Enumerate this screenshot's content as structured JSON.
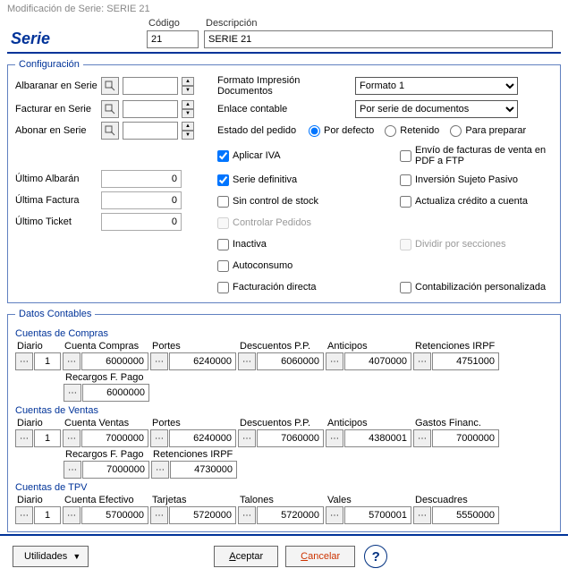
{
  "window_title": "Modificación de Serie: SERIE 21",
  "serie_label": "Serie",
  "header": {
    "codigo_label": "Código",
    "codigo_value": "21",
    "descripcion_label": "Descripción",
    "descripcion_value": "SERIE 21"
  },
  "config": {
    "legend": "Configuración",
    "albaranar_label": "Albaranar en Serie",
    "albaranar_value": "",
    "facturar_label": "Facturar en Serie",
    "facturar_value": "",
    "abonar_label": "Abonar en Serie",
    "abonar_value": "",
    "ultimo_albaran_label": "Último Albarán",
    "ultimo_albaran_value": "0",
    "ultima_factura_label": "Última Factura",
    "ultima_factura_value": "0",
    "ultimo_ticket_label": "Último Ticket",
    "ultimo_ticket_value": "0",
    "formato_label": "Formato Impresión Documentos",
    "formato_value": "Formato 1",
    "enlace_label": "Enlace contable",
    "enlace_value": "Por serie de documentos",
    "estado_label": "Estado del pedido",
    "estado_options": {
      "por_defecto": "Por defecto",
      "retenido": "Retenido",
      "para_preparar": "Para preparar"
    },
    "checks_left": {
      "aplicar_iva": "Aplicar IVA",
      "serie_definitiva": "Serie definitiva",
      "sin_control_stock": "Sin control de stock",
      "controlar_pedidos": "Controlar Pedidos",
      "inactiva": "Inactiva",
      "autoconsumo": "Autoconsumo",
      "facturacion_directa": "Facturación directa"
    },
    "checks_right": {
      "envio_pdf_ftp": "Envío de facturas de venta en PDF a FTP",
      "inversion_sujeto": "Inversión Sujeto Pasivo",
      "actualiza_credito": "Actualiza crédito a cuenta",
      "dividir_secciones": "Dividir por secciones",
      "contab_personalizada": "Contabilización personalizada"
    }
  },
  "datos": {
    "legend": "Datos Contables",
    "compras": {
      "title": "Cuentas de Compras",
      "headers": {
        "diario": "Diario",
        "cuenta": "Cuenta Compras",
        "portes": "Portes",
        "desc_pp": "Descuentos P.P.",
        "anticipos": "Anticipos",
        "ret_irpf": "Retenciones IRPF",
        "recargos": "Recargos F. Pago"
      },
      "values": {
        "diario": "1",
        "cuenta": "6000000",
        "portes": "6240000",
        "desc_pp": "6060000",
        "anticipos": "4070000",
        "ret_irpf": "4751000",
        "recargos": "6000000"
      }
    },
    "ventas": {
      "title": "Cuentas de Ventas",
      "headers": {
        "diario": "Diario",
        "cuenta": "Cuenta Ventas",
        "portes": "Portes",
        "desc_pp": "Descuentos P.P.",
        "anticipos": "Anticipos",
        "gastos": "Gastos Financ.",
        "recargos": "Recargos F. Pago",
        "ret_irpf": "Retenciones IRPF"
      },
      "values": {
        "diario": "1",
        "cuenta": "7000000",
        "portes": "6240000",
        "desc_pp": "7060000",
        "anticipos": "4380001",
        "gastos": "7000000",
        "recargos": "7000000",
        "ret_irpf": "4730000"
      }
    },
    "tpv": {
      "title": "Cuentas de TPV",
      "headers": {
        "diario": "Diario",
        "efectivo": "Cuenta Efectivo",
        "tarjetas": "Tarjetas",
        "talones": "Talones",
        "vales": "Vales",
        "descuadres": "Descuadres"
      },
      "values": {
        "diario": "1",
        "efectivo": "5700000",
        "tarjetas": "5720000",
        "talones": "5720000",
        "vales": "5700001",
        "descuadres": "5550000"
      }
    }
  },
  "footer": {
    "utilidades": "Utilidades",
    "aceptar": "Aceptar",
    "cancelar": "Cancelar"
  }
}
